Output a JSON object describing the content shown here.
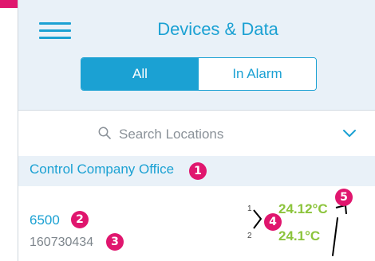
{
  "header": {
    "title": "Devices & Data",
    "tabs": [
      {
        "label": "All",
        "active": true
      },
      {
        "label": "In Alarm",
        "active": false
      }
    ]
  },
  "search": {
    "placeholder": "Search Locations"
  },
  "location": {
    "name": "Control Company Office"
  },
  "device": {
    "name": "6500",
    "serial": "160730434",
    "readings": [
      {
        "channel": "1",
        "value": "24.12°C"
      },
      {
        "channel": "2",
        "value": "24.1°C"
      }
    ]
  },
  "annotations": [
    "1",
    "2",
    "3",
    "4",
    "5"
  ],
  "colors": {
    "accent": "#1ba1d3",
    "reading": "#8cc43c",
    "badge": "#e0166e",
    "header_bg": "#e9f1f8"
  }
}
